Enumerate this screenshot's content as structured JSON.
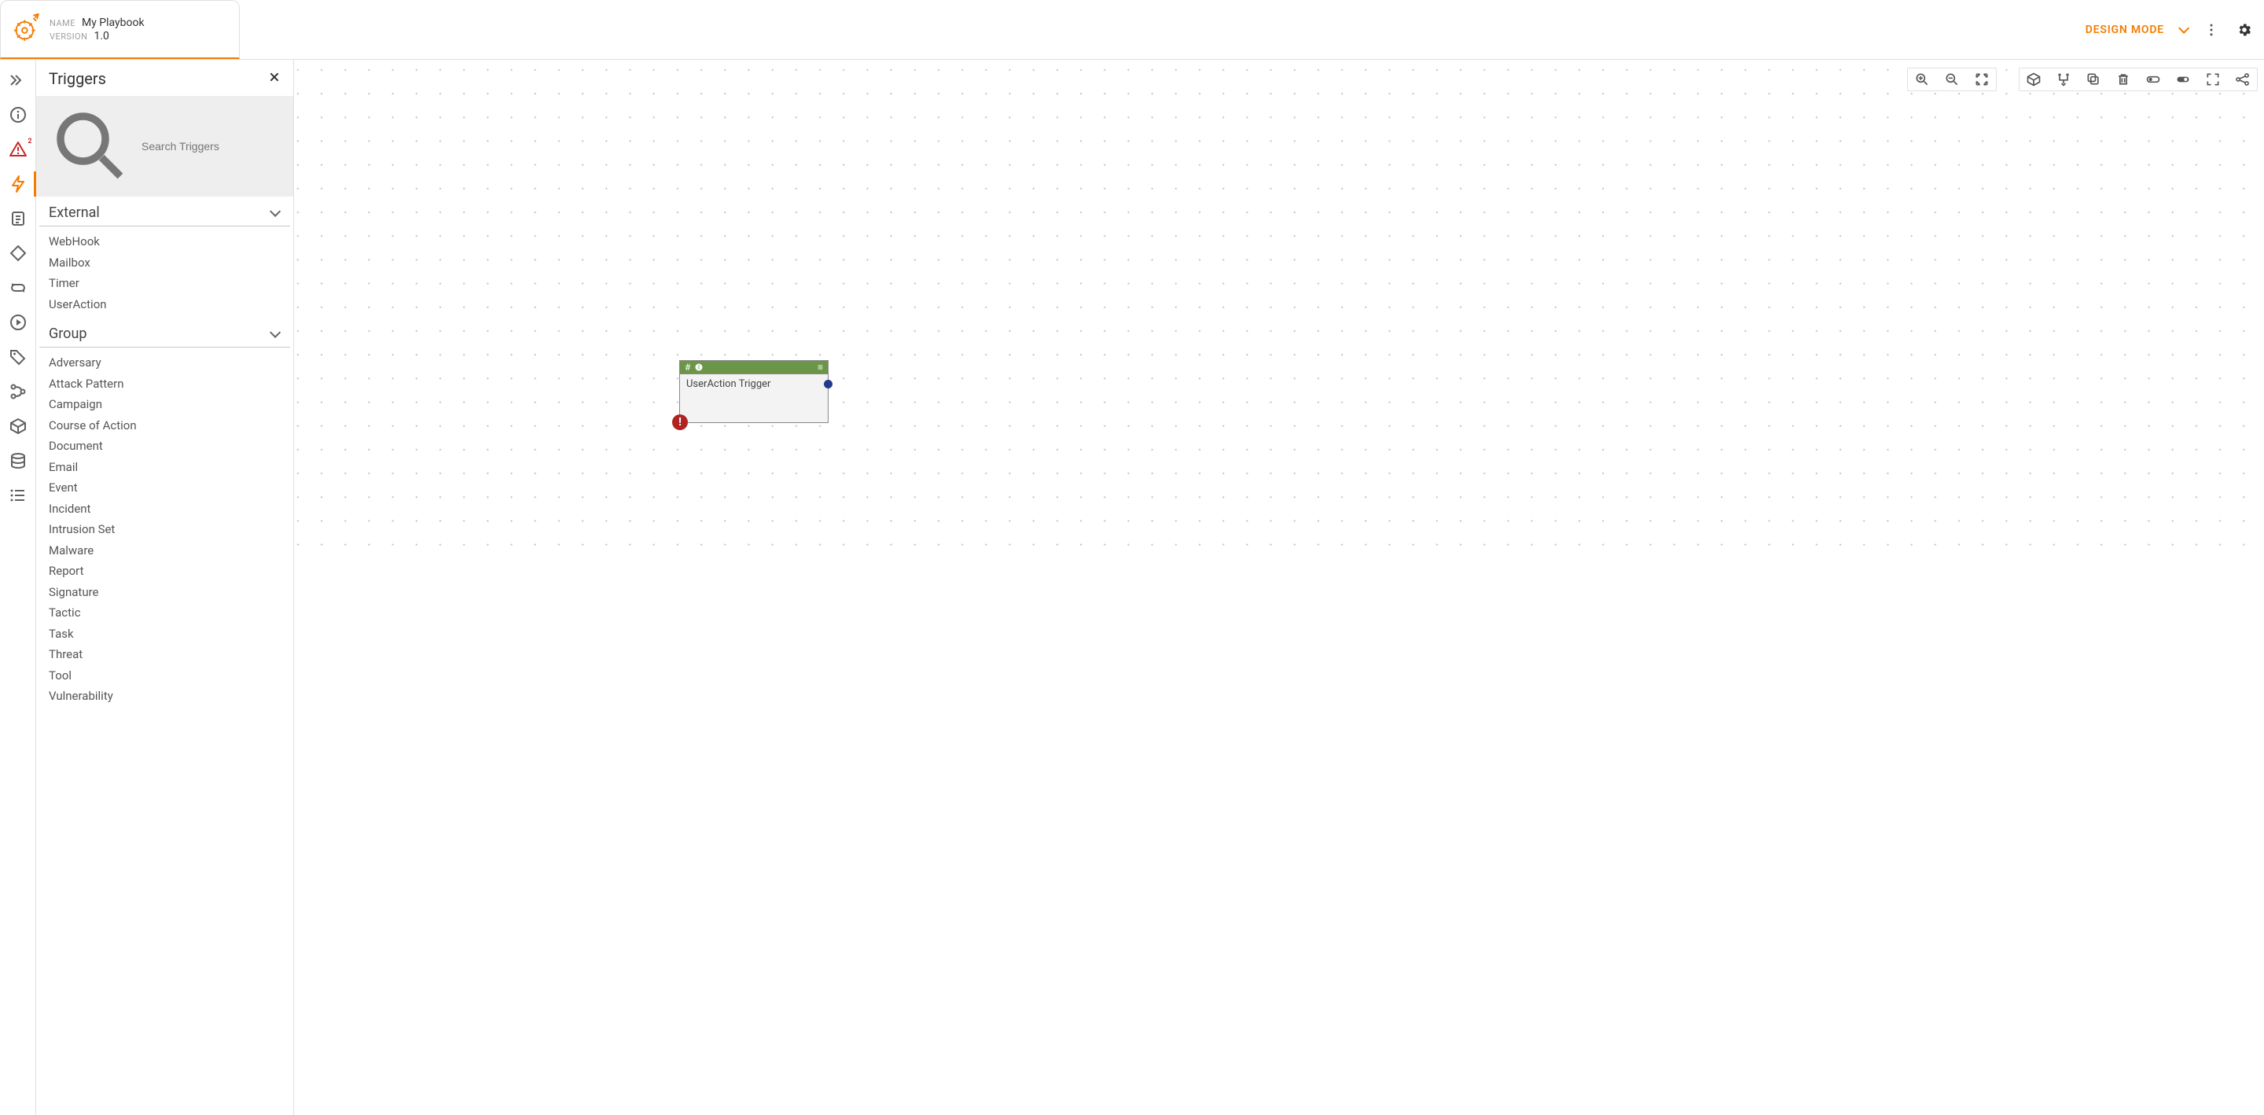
{
  "colors": {
    "accent": "#f57c00",
    "node_header": "#6b9547",
    "error": "#b02323",
    "warn": "#c62828"
  },
  "header": {
    "name_label": "NAME",
    "name_value": "My Playbook",
    "version_label": "VERSION",
    "version_value": "1.0",
    "mode": "DESIGN MODE"
  },
  "rail": {
    "warning_count": "2"
  },
  "panel": {
    "title": "Triggers",
    "search_placeholder": "Search Triggers",
    "sections": [
      {
        "title": "External",
        "items": [
          "WebHook",
          "Mailbox",
          "Timer",
          "UserAction"
        ]
      },
      {
        "title": "Group",
        "items": [
          "Adversary",
          "Attack Pattern",
          "Campaign",
          "Course of Action",
          "Document",
          "Email",
          "Event",
          "Incident",
          "Intrusion Set",
          "Malware",
          "Report",
          "Signature",
          "Tactic",
          "Task",
          "Threat",
          "Tool",
          "Vulnerability"
        ]
      }
    ]
  },
  "node": {
    "hash": "#",
    "title": "UserAction Trigger",
    "error": "!"
  },
  "icons": {
    "hamburger": "≡"
  }
}
